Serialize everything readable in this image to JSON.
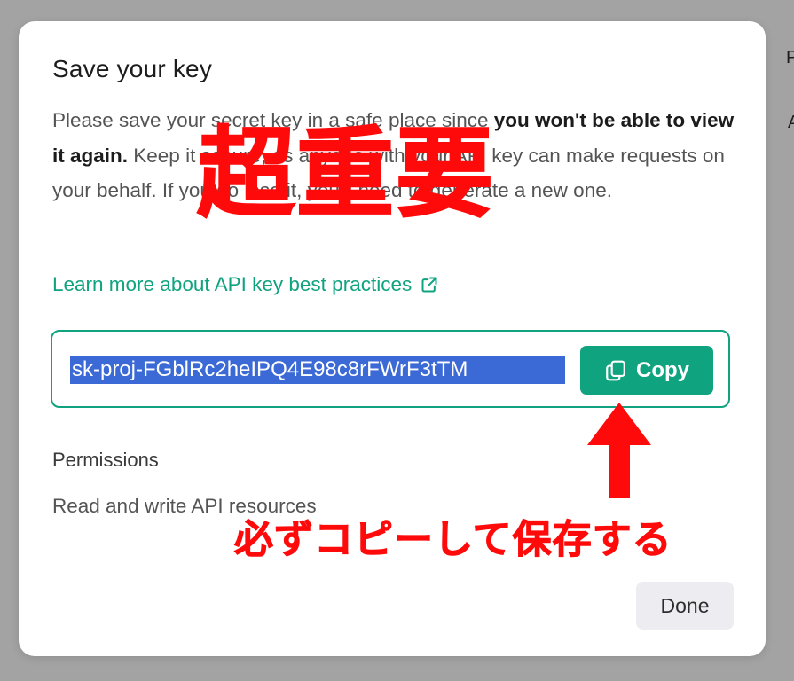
{
  "background": {
    "letter_top": "P",
    "letter_mid": "A"
  },
  "modal": {
    "title": "Save your key",
    "warning": {
      "part1": "Please save your secret key in a safe place since ",
      "bold": "you won't be able to view it again.",
      "part2": " Keep it secure, as anyone with your API key can make requests on your behalf. If you do lose it, you'll need to generate a new one."
    },
    "learn_link": {
      "label": "Learn more about API key best practices",
      "icon": "external-link-icon"
    },
    "key_value": "sk-proj-FGblRc2heIPQ4E98c8rFWrF3tTM",
    "copy_button": {
      "label": "Copy",
      "icon": "copy-icon"
    },
    "permissions": {
      "title": "Permissions",
      "value": "Read and write API resources"
    },
    "done_button": "Done"
  },
  "annotations": {
    "stamp": "超重要",
    "note": "必ずコピーして保存する",
    "arrow_icon": "up-arrow-icon",
    "color": "#ff0a0a"
  },
  "colors": {
    "accent": "#10a37f",
    "selection": "#3b6ad6",
    "overlay": "#a3a3a3"
  }
}
